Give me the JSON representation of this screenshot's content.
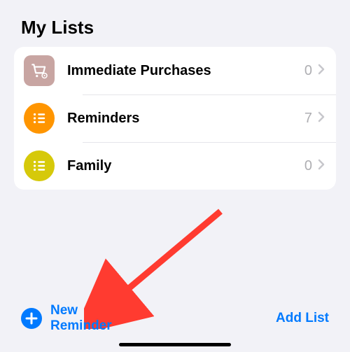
{
  "section_title": "My Lists",
  "lists": [
    {
      "name": "Immediate Purchases",
      "count": "0",
      "icon": "cart-settings-icon",
      "color": "#c8a5a2",
      "shape": "rounded-square"
    },
    {
      "name": "Reminders",
      "count": "7",
      "icon": "list-icon",
      "color": "#ff9500",
      "shape": "circle"
    },
    {
      "name": "Family",
      "count": "0",
      "icon": "list-icon",
      "color": "#d6c90a",
      "shape": "circle"
    }
  ],
  "footer": {
    "new_reminder_label": "New Reminder",
    "add_list_label": "Add List"
  },
  "colors": {
    "accent": "#007aff",
    "annotation_arrow": "#ff3b30"
  }
}
